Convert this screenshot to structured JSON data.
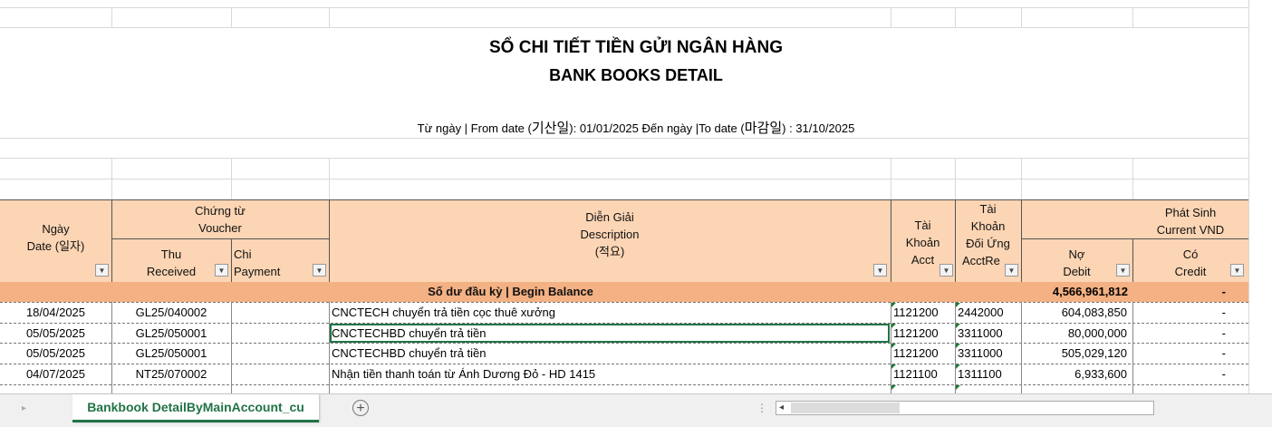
{
  "report": {
    "title_vi": "SỔ CHI TIẾT TIỀN GỬI NGÂN HÀNG",
    "title_en": "BANK BOOKS DETAIL",
    "date_range_prefix": "Từ ngày | From date (",
    "date_from_ko": "기산일",
    "date_range_middle": "): 01/01/2025 Đến ngày |To date (",
    "date_to_ko": "마감일",
    "date_range_suffix": ") : 31/10/2025"
  },
  "headers": {
    "date_vi": "Ngày",
    "date_en": "Date (일자)",
    "voucher_vi": "Chứng từ",
    "voucher_en": "Voucher",
    "received_vi": "Thu",
    "received_en": "Received",
    "payment_vi": "Chi",
    "payment_en": "Payment",
    "desc_vi": "Diễn Giải",
    "desc_en": "Description",
    "desc_ko": "(적요)",
    "acct_vi1": "Tài",
    "acct_vi2": "Khoản",
    "acct_en": "Acct",
    "contra_vi1": "Tài",
    "contra_vi2": "Khoản",
    "contra_vi3": "Đối Ứng",
    "contra_en": "AcctRe",
    "arising_vi": "Phát Sinh",
    "arising_en": "Current VND",
    "debit_vi": "Nợ",
    "debit_en": "Debit",
    "credit_vi": "Có",
    "credit_en": "Credit",
    "filter_glyph": "▼"
  },
  "begin_balance": {
    "label": "Số dư đầu kỳ | Begin Balance",
    "debit": "4,566,961,812",
    "credit": "-"
  },
  "rows": [
    {
      "date": "18/04/2025",
      "received": "GL25/040002",
      "payment": "",
      "description": "CNCTECH chuyển trả tiền cọc thuê xưởng",
      "acct": "1121200",
      "contra": "2442000",
      "debit": "604,083,850",
      "credit": "-"
    },
    {
      "date": "05/05/2025",
      "received": "GL25/050001",
      "payment": "",
      "description": "CNCTECHBD chuyển trả tiền",
      "acct": "1121200",
      "contra": "3311000",
      "debit": "80,000,000",
      "credit": "-"
    },
    {
      "date": "05/05/2025",
      "received": "GL25/050001",
      "payment": "",
      "description": "CNCTECHBD chuyển trả tiền",
      "acct": "1121200",
      "contra": "3311000",
      "debit": "505,029,120",
      "credit": "-"
    },
    {
      "date": "04/07/2025",
      "received": "NT25/070002",
      "payment": "",
      "description": "Nhận tiền thanh toán từ Ánh Dương Đỏ - HD 1415",
      "acct": "1121100",
      "contra": "1311100",
      "debit": "6,933,600",
      "credit": "-"
    }
  ],
  "sheet_tabs": {
    "active": "Bankbook DetailByMainAccount_cu",
    "prev_glyph": "◂",
    "next_glyph": "▸",
    "add_glyph": "+",
    "dots_glyph": "⋮",
    "scroll_left_glyph": "◂"
  },
  "colors": {
    "header_bg": "#fcd5b4",
    "balance_bg": "#f4b183",
    "excel_green": "#217346"
  }
}
